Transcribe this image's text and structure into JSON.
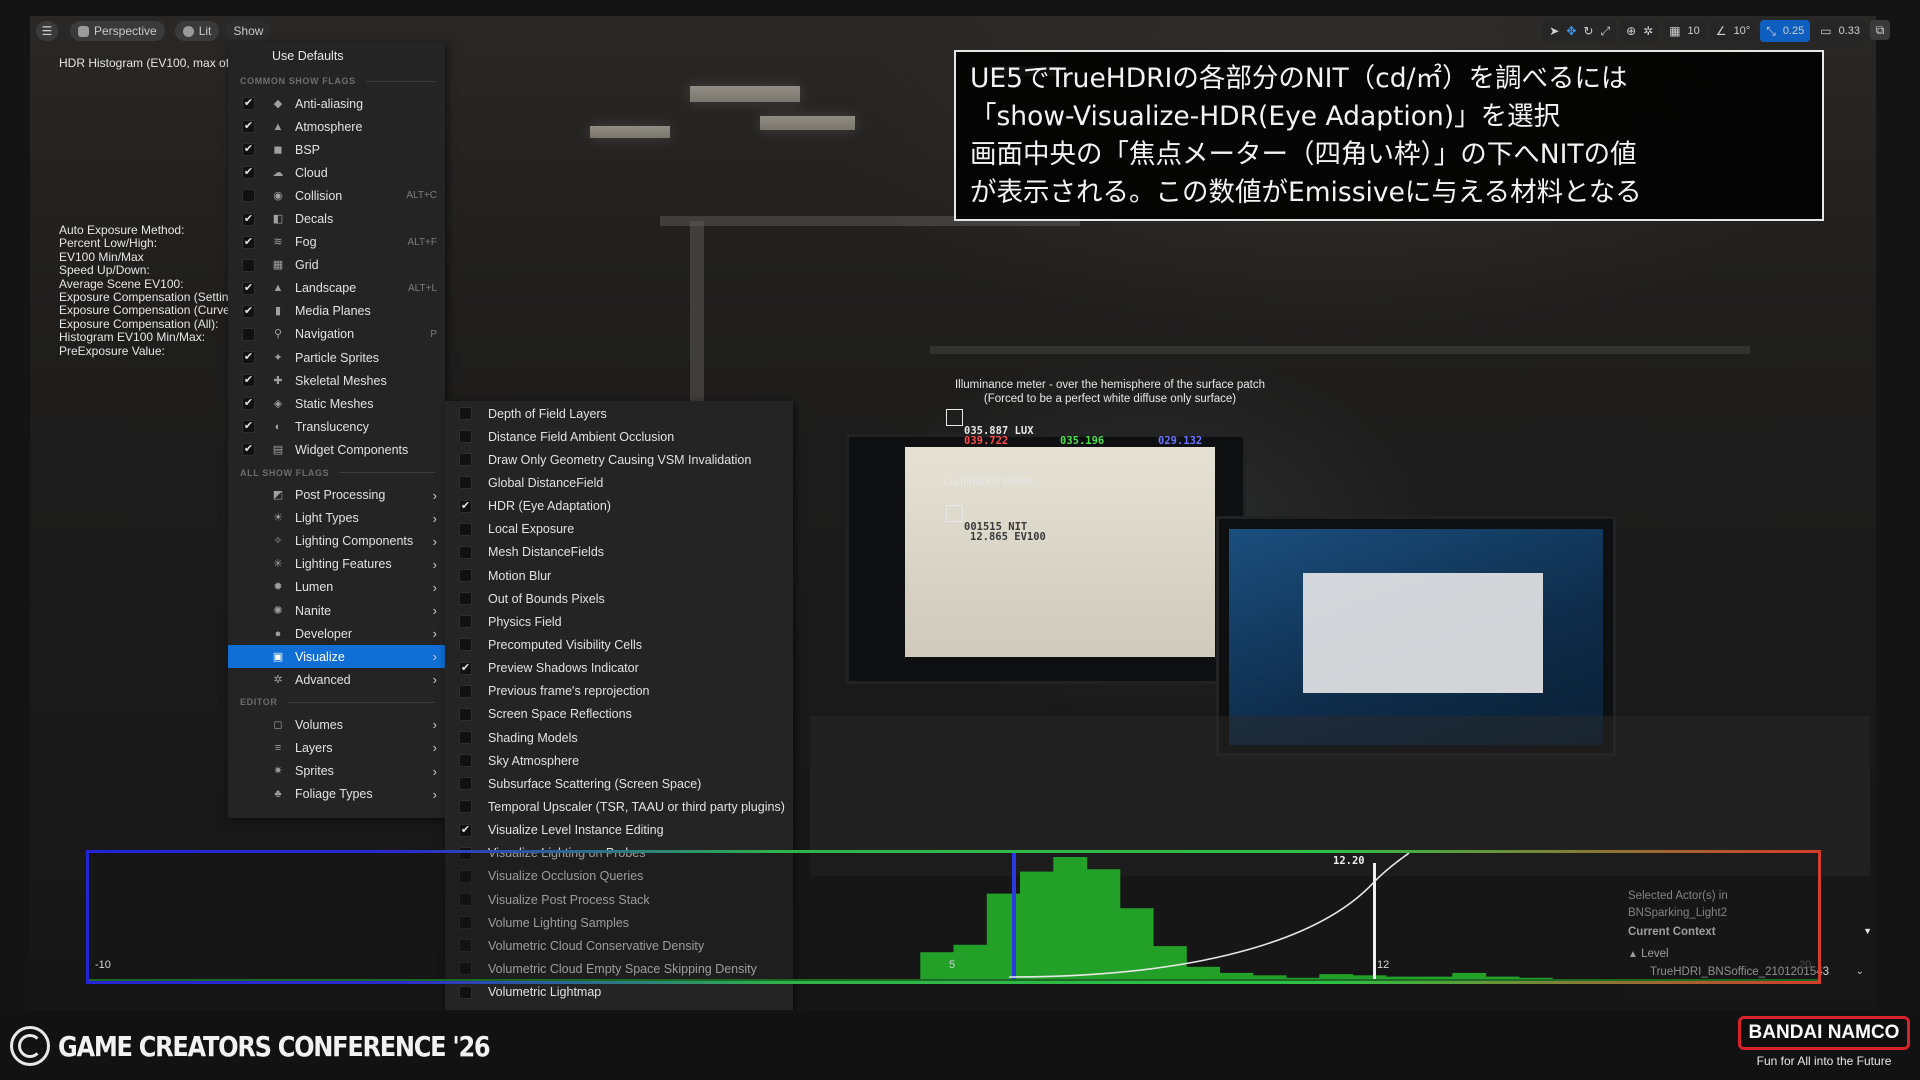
{
  "toolbar": {
    "menu_icon": "hamburger-icon",
    "perspective_label": "Perspective",
    "lit_label": "Lit",
    "show_label": "Show",
    "grid_snap_value": "10",
    "rotation_snap_value": "10°",
    "scale_snap_value": "0.25",
    "camera_speed_value": "0.33"
  },
  "overlay": {
    "hdr_title": "HDR Histogram (EV100, max of",
    "auto_exposure_lines": [
      "Auto Exposure Method:",
      "Percent Low/High:",
      "EV100 Min/Max",
      "Speed Up/Down:",
      "Average Scene EV100:",
      "Exposure Compensation (Settin",
      "Exposure Compensation (Curve",
      "Exposure Compensation (All):",
      "Histogram EV100 Min/Max:",
      "PreExposure Value:"
    ]
  },
  "show_menu": {
    "use_defaults": "Use Defaults",
    "common_header": "COMMON SHOW FLAGS",
    "common_flags": [
      {
        "label": "Anti-aliasing",
        "checked": true,
        "shortcut": "",
        "icon": "aa-icon"
      },
      {
        "label": "Atmosphere",
        "checked": true,
        "shortcut": "",
        "icon": "atmosphere-icon"
      },
      {
        "label": "BSP",
        "checked": true,
        "shortcut": "",
        "icon": "bsp-icon"
      },
      {
        "label": "Cloud",
        "checked": true,
        "shortcut": "",
        "icon": "cloud-icon"
      },
      {
        "label": "Collision",
        "checked": false,
        "shortcut": "ALT+C",
        "icon": "collision-icon"
      },
      {
        "label": "Decals",
        "checked": true,
        "shortcut": "",
        "icon": "decals-icon"
      },
      {
        "label": "Fog",
        "checked": true,
        "shortcut": "ALT+F",
        "icon": "fog-icon"
      },
      {
        "label": "Grid",
        "checked": false,
        "shortcut": "",
        "icon": "grid-icon"
      },
      {
        "label": "Landscape",
        "checked": true,
        "shortcut": "ALT+L",
        "icon": "landscape-icon"
      },
      {
        "label": "Media Planes",
        "checked": true,
        "shortcut": "",
        "icon": "media-planes-icon"
      },
      {
        "label": "Navigation",
        "checked": false,
        "shortcut": "P",
        "icon": "navigation-icon"
      },
      {
        "label": "Particle Sprites",
        "checked": true,
        "shortcut": "",
        "icon": "particle-icon"
      },
      {
        "label": "Skeletal Meshes",
        "checked": true,
        "shortcut": "",
        "icon": "skeletal-icon"
      },
      {
        "label": "Static Meshes",
        "checked": true,
        "shortcut": "",
        "icon": "static-mesh-icon"
      },
      {
        "label": "Translucency",
        "checked": true,
        "shortcut": "",
        "icon": "translucency-icon"
      },
      {
        "label": "Widget Components",
        "checked": true,
        "shortcut": "",
        "icon": "widget-icon"
      }
    ],
    "all_header": "ALL SHOW FLAGS",
    "all_flags": [
      {
        "label": "Post Processing",
        "icon": "post-process-icon",
        "active": false
      },
      {
        "label": "Light Types",
        "icon": "light-types-icon",
        "active": false
      },
      {
        "label": "Lighting Components",
        "icon": "lighting-components-icon",
        "active": false
      },
      {
        "label": "Lighting Features",
        "icon": "lighting-features-icon",
        "active": false
      },
      {
        "label": "Lumen",
        "icon": "lumen-icon",
        "active": false
      },
      {
        "label": "Nanite",
        "icon": "nanite-icon",
        "active": false
      },
      {
        "label": "Developer",
        "icon": "developer-icon",
        "active": false
      },
      {
        "label": "Visualize",
        "icon": "visualize-icon",
        "active": true
      },
      {
        "label": "Advanced",
        "icon": "advanced-icon",
        "active": false
      }
    ],
    "editor_header": "EDITOR",
    "editor_flags": [
      {
        "label": "Volumes",
        "icon": "volumes-icon"
      },
      {
        "label": "Layers",
        "icon": "layers-icon"
      },
      {
        "label": "Sprites",
        "icon": "sprites-icon"
      },
      {
        "label": "Foliage Types",
        "icon": "foliage-icon"
      }
    ]
  },
  "visualize_menu": [
    {
      "label": "Depth of Field Layers",
      "checked": false
    },
    {
      "label": "Distance Field Ambient Occlusion",
      "checked": false
    },
    {
      "label": "Draw Only Geometry Causing VSM Invalidation",
      "checked": false
    },
    {
      "label": "Global DistanceField",
      "checked": false
    },
    {
      "label": "HDR (Eye Adaptation)",
      "checked": true
    },
    {
      "label": "Local Exposure",
      "checked": false
    },
    {
      "label": "Mesh DistanceFields",
      "checked": false
    },
    {
      "label": "Motion Blur",
      "checked": false
    },
    {
      "label": "Out of Bounds Pixels",
      "checked": false
    },
    {
      "label": "Physics Field",
      "checked": false
    },
    {
      "label": "Precomputed Visibility Cells",
      "checked": false
    },
    {
      "label": "Preview Shadows Indicator",
      "checked": true
    },
    {
      "label": "Previous frame's reprojection",
      "checked": false
    },
    {
      "label": "Screen Space Reflections",
      "checked": false
    },
    {
      "label": "Shading Models",
      "checked": false
    },
    {
      "label": "Sky Atmosphere",
      "checked": false
    },
    {
      "label": "Subsurface Scattering (Screen Space)",
      "checked": false
    },
    {
      "label": "Temporal Upscaler (TSR, TAAU or third party plugins)",
      "checked": false
    },
    {
      "label": "Visualize Level Instance Editing",
      "checked": true
    },
    {
      "label": "Visualize Lighting on Probes",
      "checked": false
    },
    {
      "label": "Visualize Occlusion Queries",
      "checked": false
    },
    {
      "label": "Visualize Post Process Stack",
      "checked": false
    },
    {
      "label": "Volume Lighting Samples",
      "checked": false
    },
    {
      "label": "Volumetric Cloud Conservative Density",
      "checked": false
    },
    {
      "label": "Volumetric Cloud Empty Space Skipping Density",
      "checked": false
    },
    {
      "label": "Volumetric Lightmap",
      "checked": false
    }
  ],
  "annotation": {
    "lines": [
      "UE5でTrueHDRIの各部分のNIT（cd/㎡）を調べるには",
      "「show-Visualize-HDR(Eye Adaption)」を選択",
      "画面中央の「焦点メーター（四角い枠）」の下へNITの値",
      "が表示される。この数値がEmissiveに与える材料となる"
    ]
  },
  "illuminance_meter": {
    "title_line1": "Illuminance meter - over the hemisphere of the surface patch",
    "title_line2": "(Forced to be a perfect white diffuse only surface)",
    "lux_value": "035.887 LUX",
    "red_value": "039.722",
    "green_value": "035.196",
    "blue_value": "029.132"
  },
  "luminance_meter": {
    "title": "Luminance meter",
    "nit_value": "001515 NIT",
    "ev_value": "12.865 EV100"
  },
  "histogram": {
    "min_label": "-10",
    "mid_label": "5",
    "marker_label": "12",
    "marker_value": "12.20",
    "max_label": "20",
    "bins": [
      0,
      0,
      0,
      0,
      0,
      0,
      0,
      0,
      0,
      0,
      0,
      0,
      0,
      0,
      0,
      0,
      0,
      0,
      0,
      0,
      0,
      0,
      0,
      0,
      0,
      0.22,
      0.28,
      0.7,
      0.88,
      1.0,
      0.9,
      0.58,
      0.27,
      0.1,
      0.05,
      0.03,
      0.01,
      0.04,
      0.03,
      0.02,
      0.02,
      0.05,
      0.02,
      0.01,
      0,
      0,
      0,
      0,
      0,
      0,
      0,
      0
    ],
    "colors": {
      "low": "#2323d8",
      "mid": "#2fb34a",
      "high": "#d63c2a",
      "bars": "#22a028"
    }
  },
  "context_panel": {
    "selected_label": "Selected Actor(s) in",
    "selected_value": "BNSparking_Light2",
    "current_context": "Current Context",
    "level_label": "Level",
    "level_value": "TrueHDRI_BNSoffice_2101201543"
  },
  "footer": {
    "conference": "GAME CREATORS CONFERENCE '26",
    "brand": "BANDAI NAMCO",
    "tagline": "Fun for All into the Future",
    "brand_color": "#d8232a"
  }
}
